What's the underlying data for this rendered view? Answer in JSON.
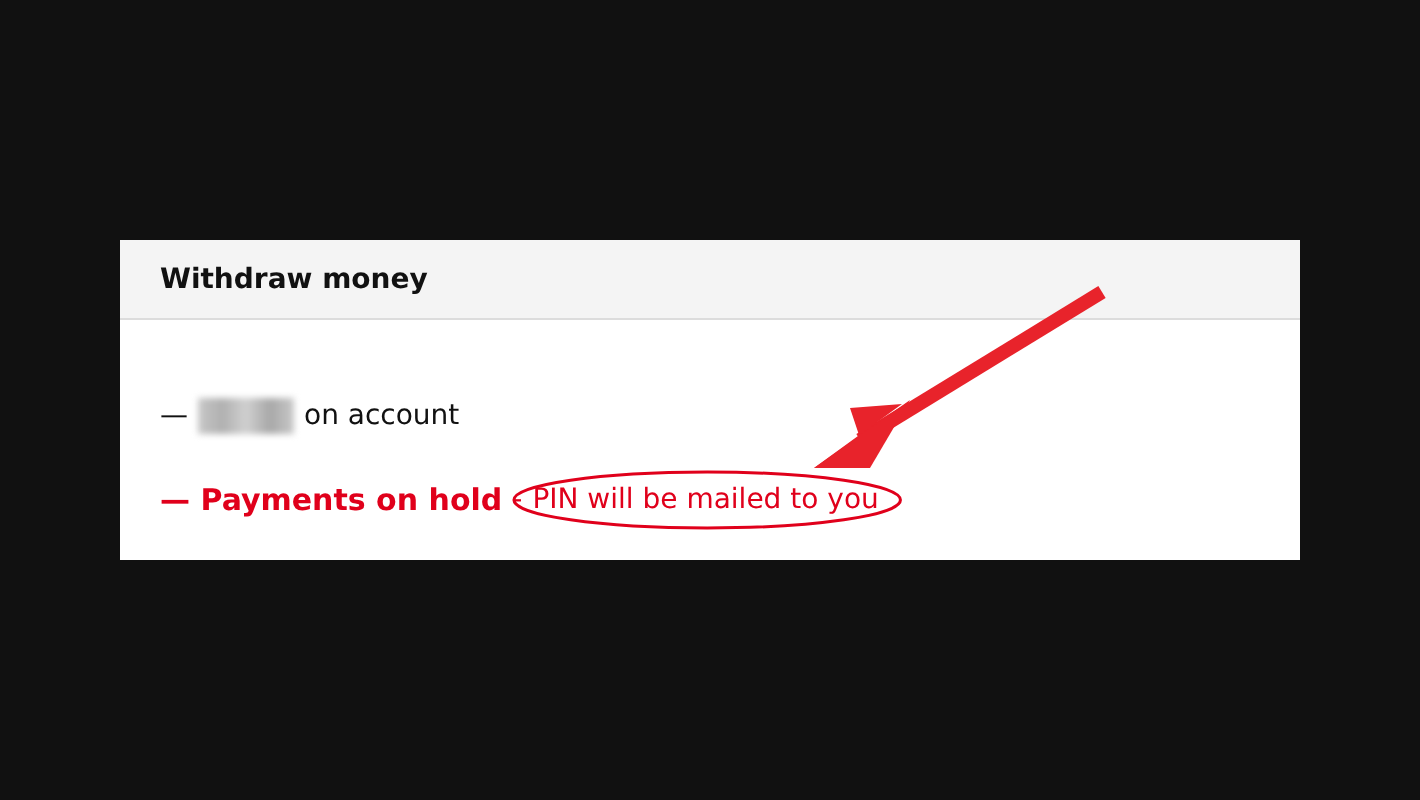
{
  "panel": {
    "title": "Withdraw money"
  },
  "balance": {
    "dash": "—",
    "amount_redacted": true,
    "text": "on account"
  },
  "status": {
    "label": "— Payments on hold",
    "separator": "-",
    "note": "PIN will be mailed to you",
    "note_circled": true
  },
  "annotation": {
    "arrow": true
  }
}
